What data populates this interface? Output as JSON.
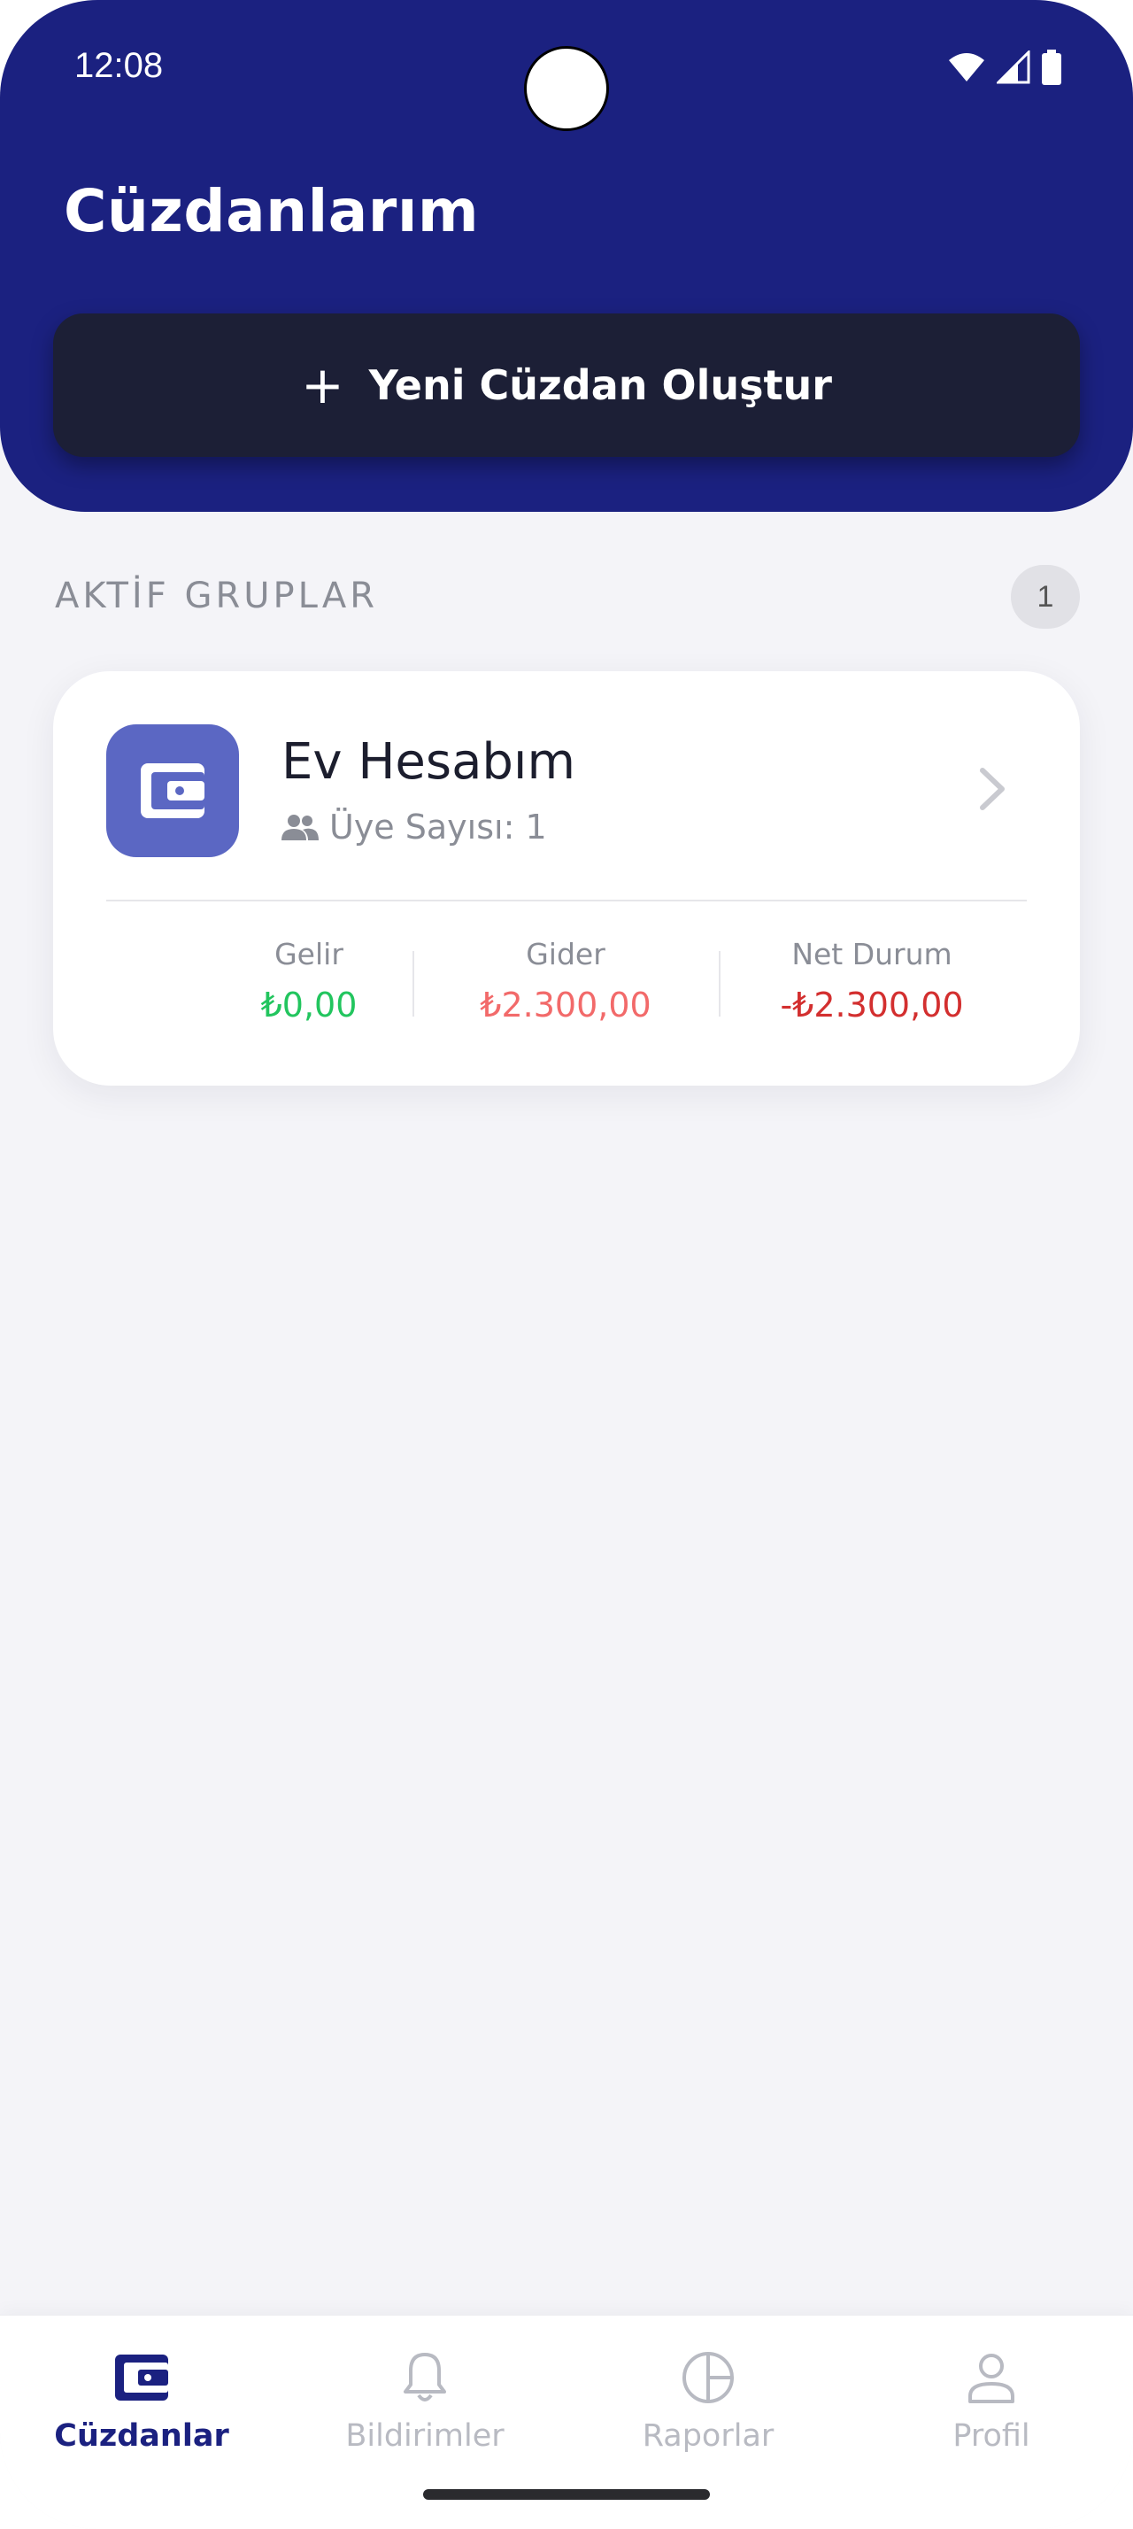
{
  "status_bar": {
    "time": "12:08",
    "icons": [
      "wifi-icon",
      "signal-icon",
      "battery-icon"
    ]
  },
  "header": {
    "title": "Cüzdanlarım",
    "new_wallet_button": {
      "icon": "plus-icon",
      "label": "Yeni Cüzdan Oluştur"
    }
  },
  "section": {
    "title": "AKTİF GRUPLAR",
    "count": "1"
  },
  "wallets": [
    {
      "name": "Ev Hesabım",
      "icon": "wallet-icon",
      "members_icon": "people-icon",
      "members_text": "Üye Sayısı: 1",
      "stats": [
        {
          "label": "Gelir",
          "value": "₺0,00",
          "color": "#22c55e"
        },
        {
          "label": "Gider",
          "value": "₺2.300,00",
          "color": "#f26a6a"
        },
        {
          "label": "Net Durum",
          "value": "-₺2.300,00",
          "color": "#d32f2f"
        }
      ]
    }
  ],
  "bottom_nav": {
    "items": [
      {
        "label": "Cüzdanlar",
        "icon": "wallet-icon",
        "active": true
      },
      {
        "label": "Bildirimler",
        "icon": "bell-icon",
        "active": false
      },
      {
        "label": "Raporlar",
        "icon": "pie-chart-icon",
        "active": false
      },
      {
        "label": "Profil",
        "icon": "person-icon",
        "active": false
      }
    ]
  },
  "colors": {
    "primary": "#1b2180",
    "button_dark": "#1c1f36",
    "wallet_avatar": "#5b67c3",
    "background": "#f4f4f8",
    "nav_inactive": "#b8bac2"
  }
}
